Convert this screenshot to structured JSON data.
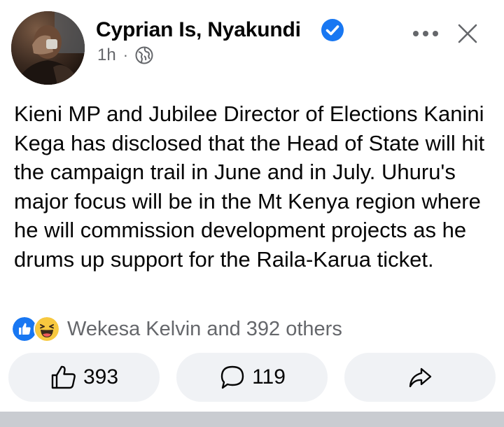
{
  "author": {
    "name": "Cyprian Is, Nyakundi",
    "verified": true,
    "time": "1h",
    "separator": "·",
    "audience_icon": "globe-icon"
  },
  "header_actions": {
    "more_icon": "more-horizontal-icon",
    "close_icon": "close-icon"
  },
  "post": {
    "text": "Kieni MP and Jubilee Director of Elections Kanini Kega has disclosed that the Head of State will hit the campaign trail in June and in July. Uhuru's major focus will be in the Mt Kenya region where he will commission development projects as he drums up support for the Raila-Karua ticket."
  },
  "reactions": {
    "icons": [
      "like-reaction-icon",
      "haha-reaction-icon"
    ],
    "summary": "Wekesa Kelvin and 392 others"
  },
  "actions": {
    "like_count": "393",
    "comment_count": "119",
    "share_icon": "share-icon"
  },
  "colors": {
    "primary_text": "#050505",
    "secondary_text": "#65676b",
    "button_bg": "#f0f2f5",
    "verified_blue": "#1877f2",
    "haha_yellow": "#f7c83f"
  }
}
